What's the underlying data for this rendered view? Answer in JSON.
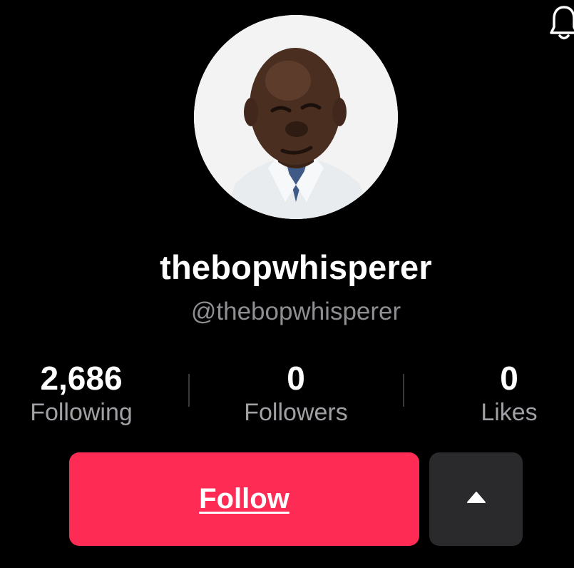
{
  "profile": {
    "display_name": "thebopwhisperer",
    "handle": "@thebopwhisperer",
    "avatar": "profile-photo"
  },
  "stats": {
    "following": {
      "value": "2,686",
      "label": "Following"
    },
    "followers": {
      "value": "0",
      "label": "Followers"
    },
    "likes": {
      "value": "0",
      "label": "Likes"
    }
  },
  "actions": {
    "follow_label": "Follow",
    "more_icon": "triangle-up-icon"
  },
  "top_bar": {
    "notification_icon": "bell-icon"
  },
  "colors": {
    "background": "#000000",
    "follow_button": "#fe2c55",
    "secondary_button": "#2a2a2c",
    "muted_text": "#8e8e93"
  }
}
